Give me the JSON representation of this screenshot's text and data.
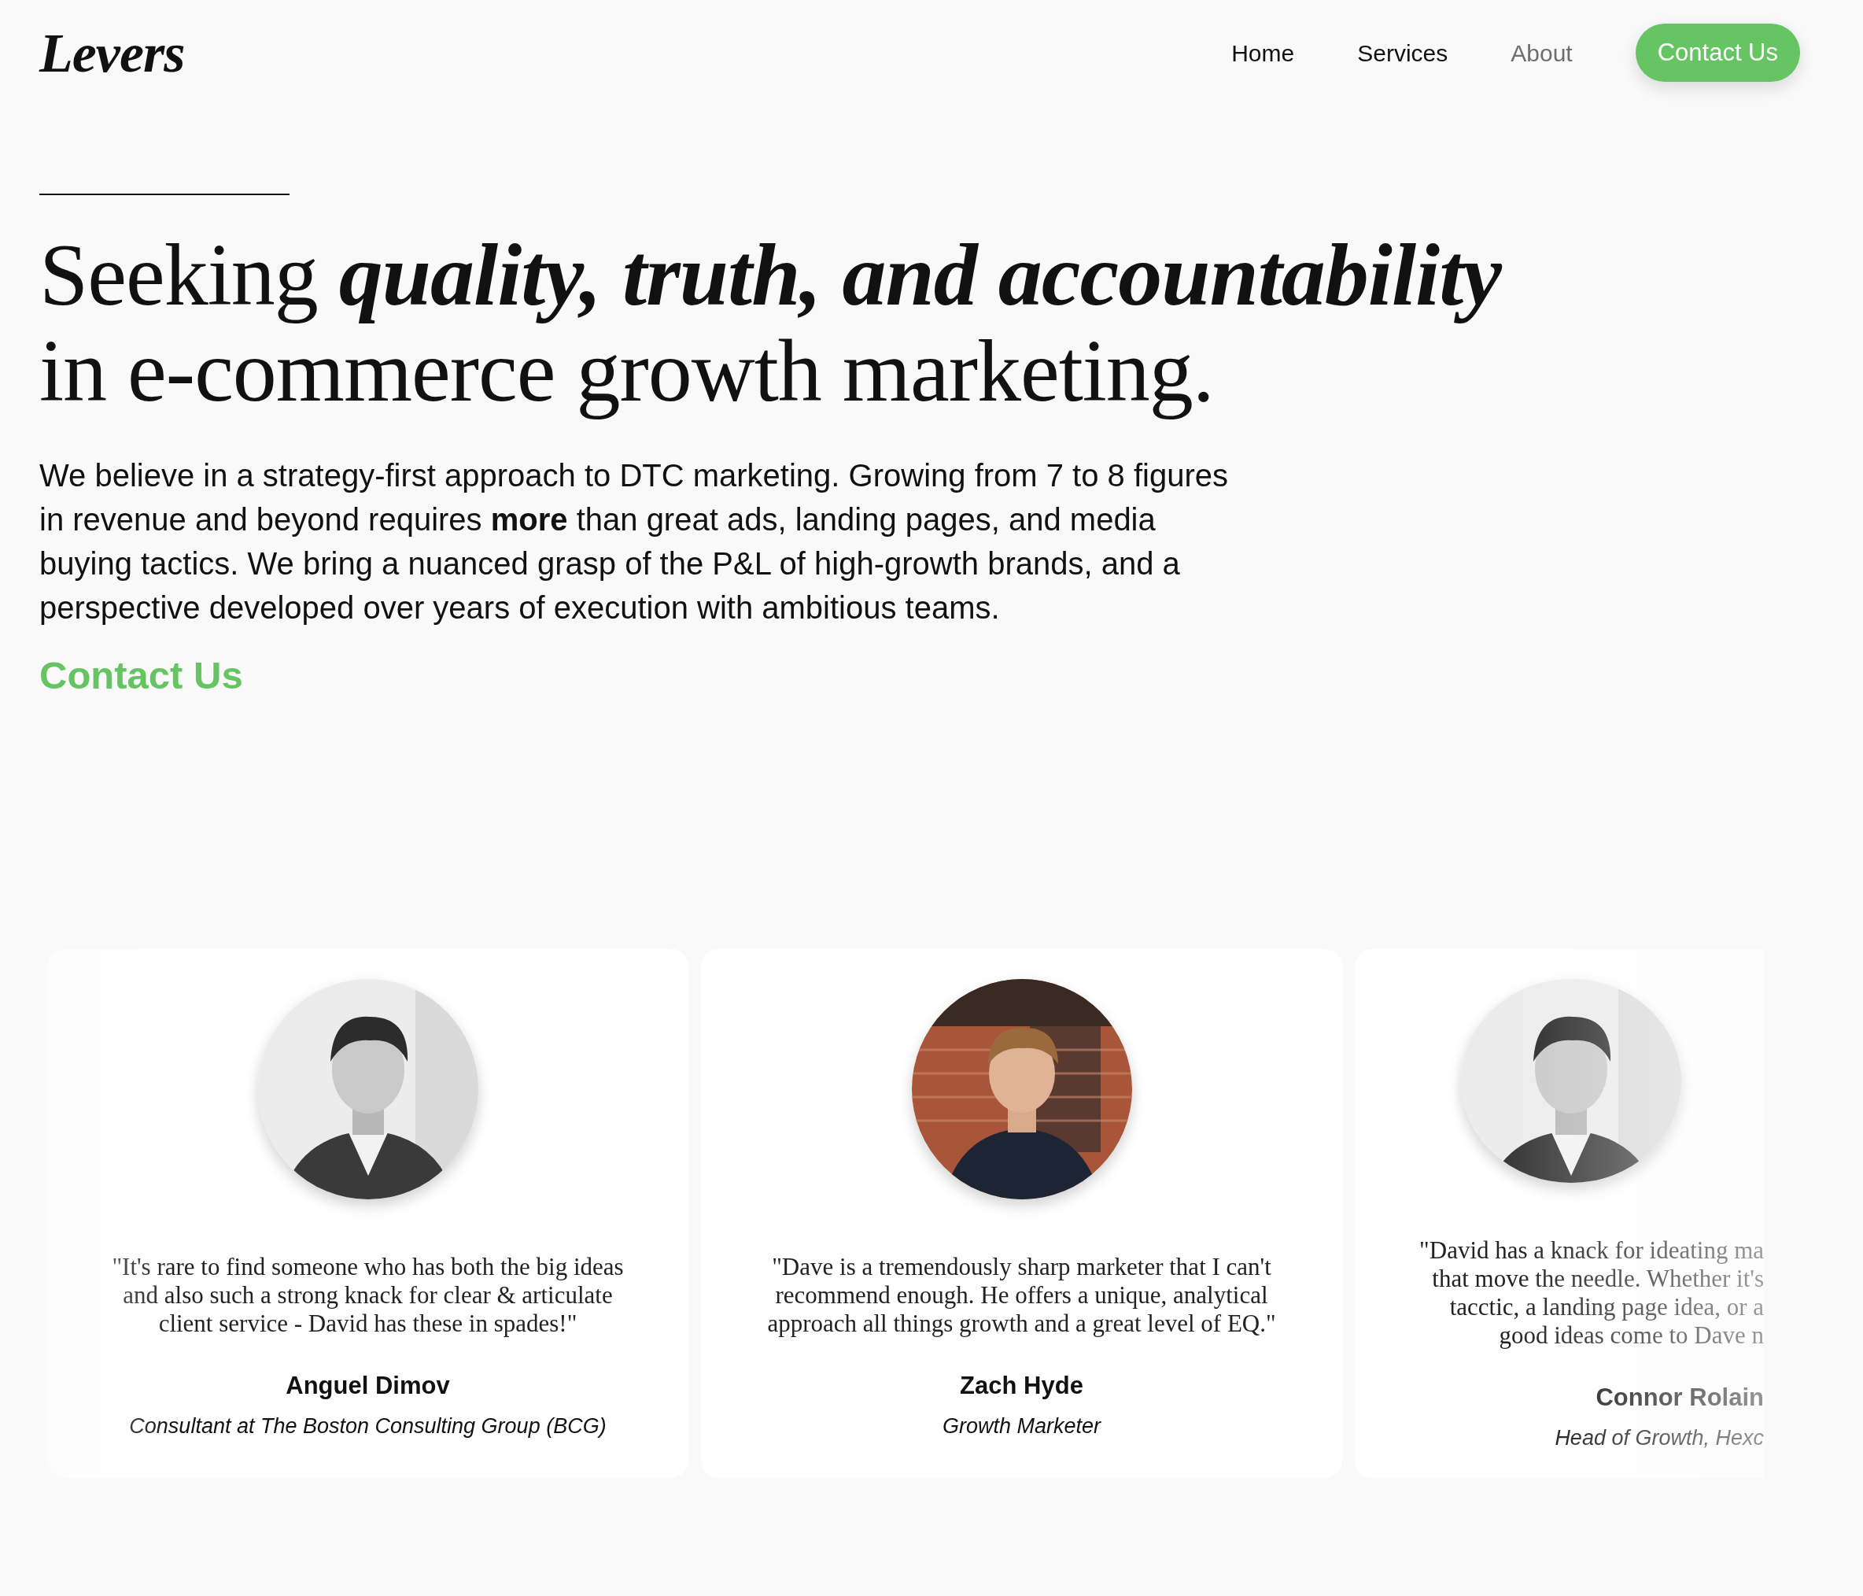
{
  "logo": "Levers",
  "nav": [
    {
      "label": "Home",
      "selected": false
    },
    {
      "label": "Services",
      "selected": false
    },
    {
      "label": "About",
      "selected": true
    }
  ],
  "nav_button": "Contact Us",
  "headline": [
    "Seeking *quality, truth, and accountability*",
    "in e-commerce growth marketing."
  ],
  "intro": "We believe in a strategy-first approach to DTC marketing. Growing from 7 to 8 figures in revenue and beyond requires **more** than great ads, landing pages, and media buying tactics. We bring a nuanced grasp of the P&L of high-growth brands, and a perspective developed over years of execution with ambitious teams.",
  "contact_link": "Contact Us",
  "testimonials": [
    {
      "kind": "gray",
      "cut": false,
      "quote": [
        "\"It's rare to find someone who has both the big ideas",
        "and also such a strong knack for clear & articulate",
        "client service - David has these in spades!\""
      ],
      "name": "Anguel Dimov",
      "title": "Consultant at The Boston Consulting Group (BCG)"
    },
    {
      "kind": "brick",
      "cut": false,
      "quote": [
        "\"Dave is a tremendously sharp marketer that I can't",
        "recommend enough. He offers a unique, analytical",
        "approach all things growth and a great level of EQ.\""
      ],
      "name": "Zach Hyde",
      "title": "Growth Marketer"
    },
    {
      "kind": "gray",
      "cut": true,
      "quote": [
        "\"David has a knack for ideating ma",
        "that move the needle. Whether it's",
        "tacctic, a landing page idea, or a",
        "good ideas come to Dave n"
      ],
      "name": "Connor Rolain",
      "title": "Head of Growth, Hexc"
    }
  ]
}
